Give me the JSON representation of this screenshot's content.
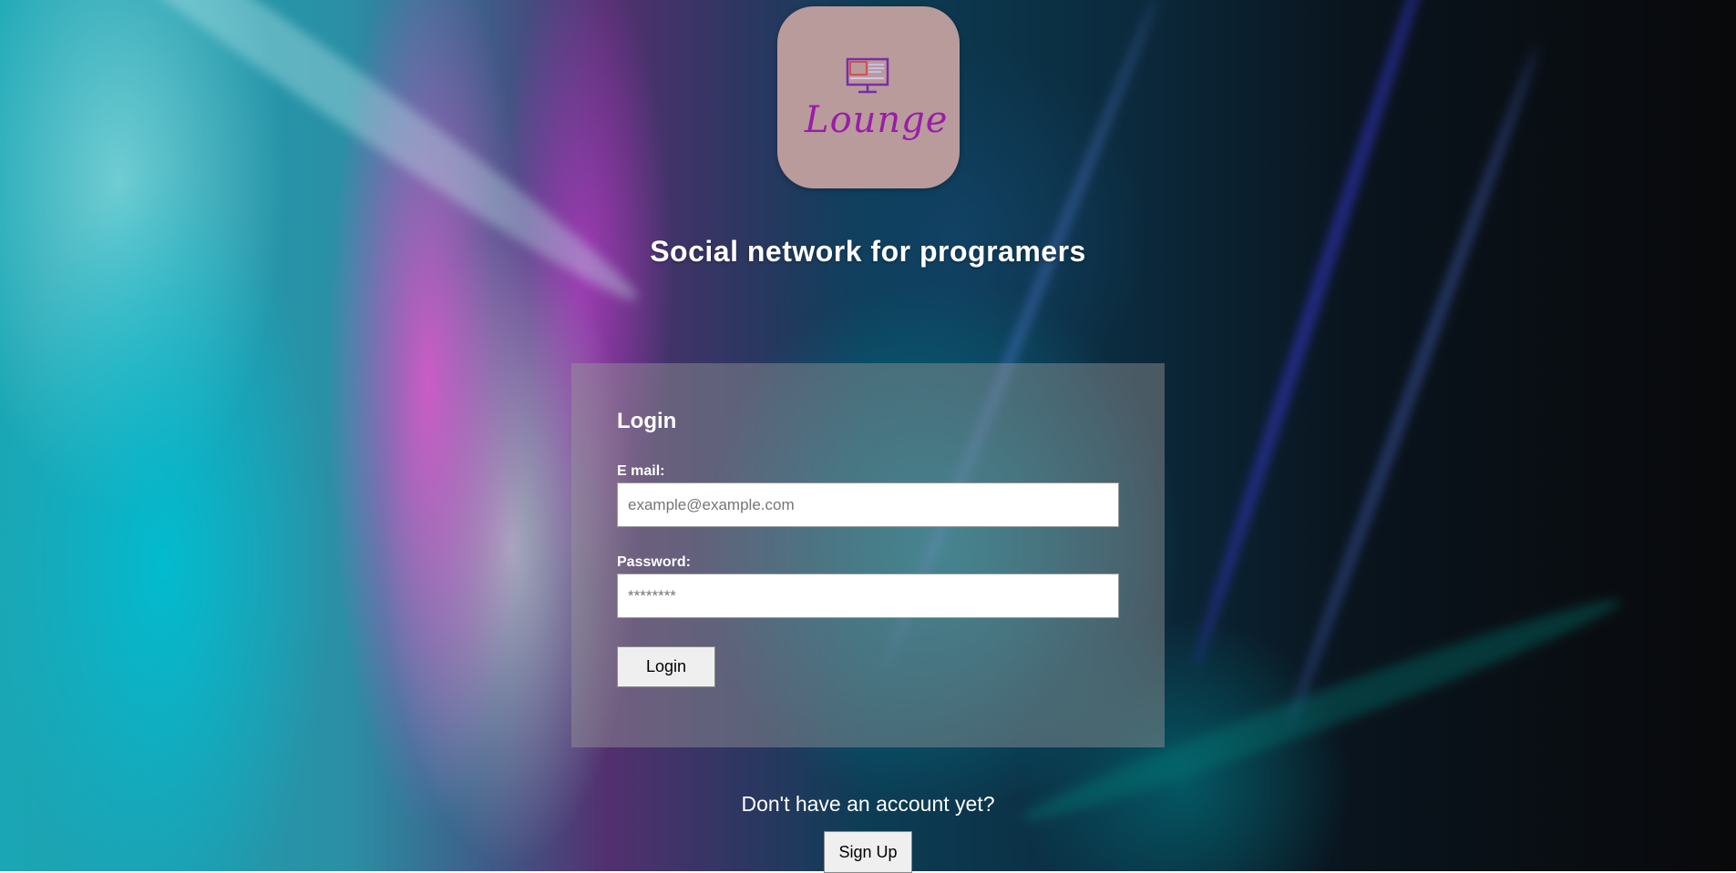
{
  "logo": {
    "text": "Lounge",
    "icon": "monitor-icon",
    "tile_color": "#b99b9c",
    "text_color": "#9a1ca9"
  },
  "tagline": "Social network for programers",
  "login_form": {
    "title": "Login",
    "email_label": "E mail:",
    "email_placeholder": "example@example.com",
    "password_label": "Password:",
    "password_placeholder": "********",
    "submit_label": "Login"
  },
  "signup": {
    "prompt": "Don't have an account yet?",
    "button_label": "Sign Up"
  }
}
